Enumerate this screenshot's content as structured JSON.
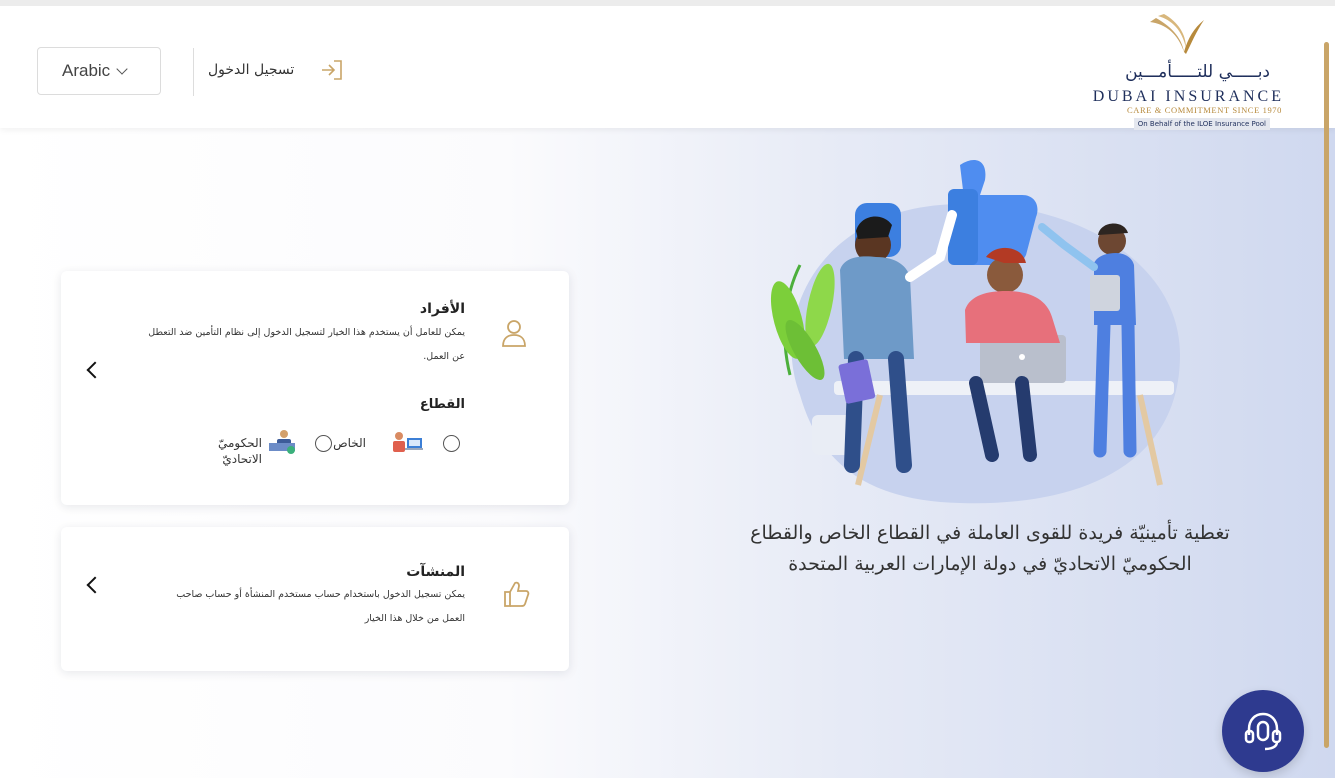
{
  "header": {
    "language_select": "Arabic",
    "login_label": "تسجيل الدخول",
    "logo": {
      "arabic_text": "دبـــــي للتـــــأمـــين",
      "english_text": "DUBAI INSURANCE",
      "tagline": "CARE & COMMITMENT SINCE 1970",
      "pool_text": "On Behalf of the ILOE Insurance Pool"
    }
  },
  "cards": {
    "individuals": {
      "title": "الأفراد",
      "description": "يمكن للعامل أن يستخدم هذا الخيار لتسجيل الدخول إلى نظام التأمين ضد التعطل عن العمل.",
      "sector_title": "القطاع",
      "options": {
        "private": "الخاص",
        "government": "الحكوميّ الاتحاديّ"
      }
    },
    "establishments": {
      "title": "المنشآت",
      "description": "يمكن تسجيل الدخول باستخدام حساب مستخدم المنشأة أو حساب صاحب العمل من خلال هذا الخيار"
    }
  },
  "hero": {
    "tagline": "تغطية تأمينيّة فريدة للقوى العاملة في القطاع الخاص والقطاع الحكوميّ الاتحاديّ في دولة الإمارات العربية المتحدة"
  },
  "colors": {
    "brand_navy": "#1f2f5c",
    "brand_gold": "#c9a568",
    "support_button": "#2e3a8f"
  },
  "icons": [
    "chevron-down-icon",
    "login-arrow-icon",
    "user-icon",
    "thumbs-up-icon",
    "chevron-left-icon",
    "headset-icon"
  ]
}
